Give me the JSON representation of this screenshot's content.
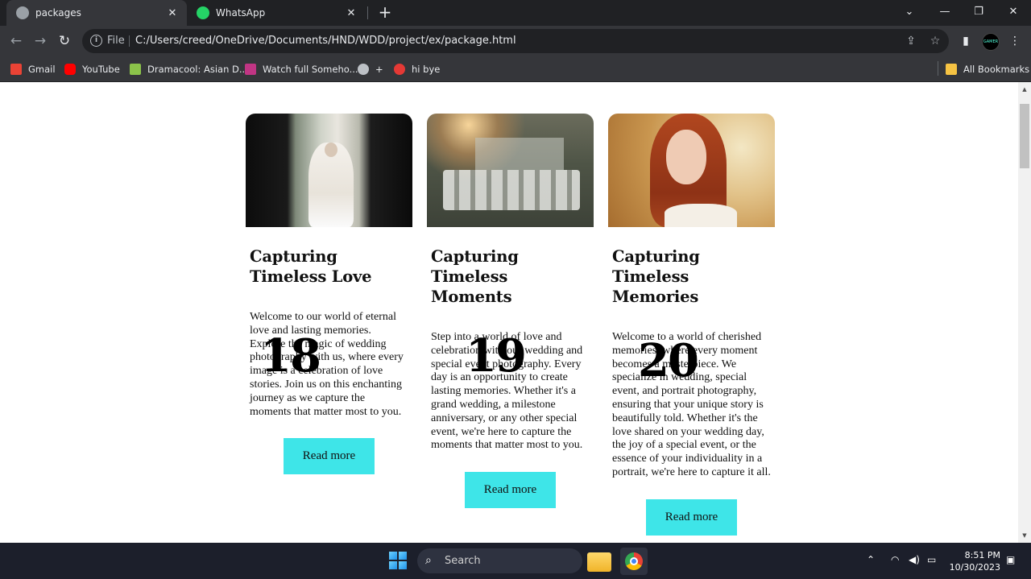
{
  "tabs": [
    {
      "title": "packages",
      "active": true,
      "icon": "globe-icon"
    },
    {
      "title": "WhatsApp",
      "active": false,
      "icon": "whatsapp-icon"
    }
  ],
  "window_controls": {
    "dropdown": "⌄",
    "minimize": "—",
    "restore": "❐",
    "close": "✕"
  },
  "address_bar": {
    "scheme_label": "File",
    "url": "C:/Users/creed/OneDrive/Documents/HND/WDD/project/ex/package.html"
  },
  "bookmarks": [
    {
      "label": "Gmail",
      "icon": "gmail-icon",
      "color": "#ea4335"
    },
    {
      "label": "YouTube",
      "icon": "youtube-icon",
      "color": "#ff0000"
    },
    {
      "label": "Dramacool: Asian D...",
      "icon": "dramacool-icon",
      "color": "#8bc34a"
    },
    {
      "label": "Watch full Someho...",
      "icon": "watch-icon",
      "color": "#c13584"
    },
    {
      "label": "+",
      "icon": "globe-icon",
      "color": "#bdc1c6"
    },
    {
      "label": "hi bye",
      "icon": "m-icon",
      "color": "#e53935"
    }
  ],
  "all_bookmarks_label": "All Bookmarks",
  "cards": [
    {
      "title": "Capturing Timeless Love",
      "text": "Welcome to our world of eternal love and lasting memories. Explore the magic of wedding photography with us, where every image is a celebration of love stories. Join us on this enchanting journey as we capture the moments that matter most to you.",
      "button": "Read more",
      "overlay_number": "18"
    },
    {
      "title": "Capturing Timeless Moments",
      "text": "Step into a world of love and celebration with our wedding and special event photography. Every day is an opportunity to create lasting memories. Whether it's a grand wedding, a milestone anniversary, or any other special event, we're here to capture the moments that matter most to you.",
      "button": "Read more",
      "overlay_number": "19"
    },
    {
      "title": "Capturing Timeless Memories",
      "text": "Welcome to a world of cherished memories, where every moment becomes a masterpiece. We specialize in wedding, special event, and portrait photography, ensuring that your unique story is beautifully told. Whether it's the love shared on your wedding day, the joy of a special event, or the essence of your individuality in a portrait, we're here to capture it all.",
      "button": "Read more",
      "overlay_number": "20"
    }
  ],
  "taskbar": {
    "search_label": "Search",
    "time": "8:51 PM",
    "date": "10/30/2023"
  },
  "colors": {
    "accent_button": "#3ee5e8",
    "chrome_dark": "#202124",
    "chrome_toolbar": "#35363a"
  }
}
